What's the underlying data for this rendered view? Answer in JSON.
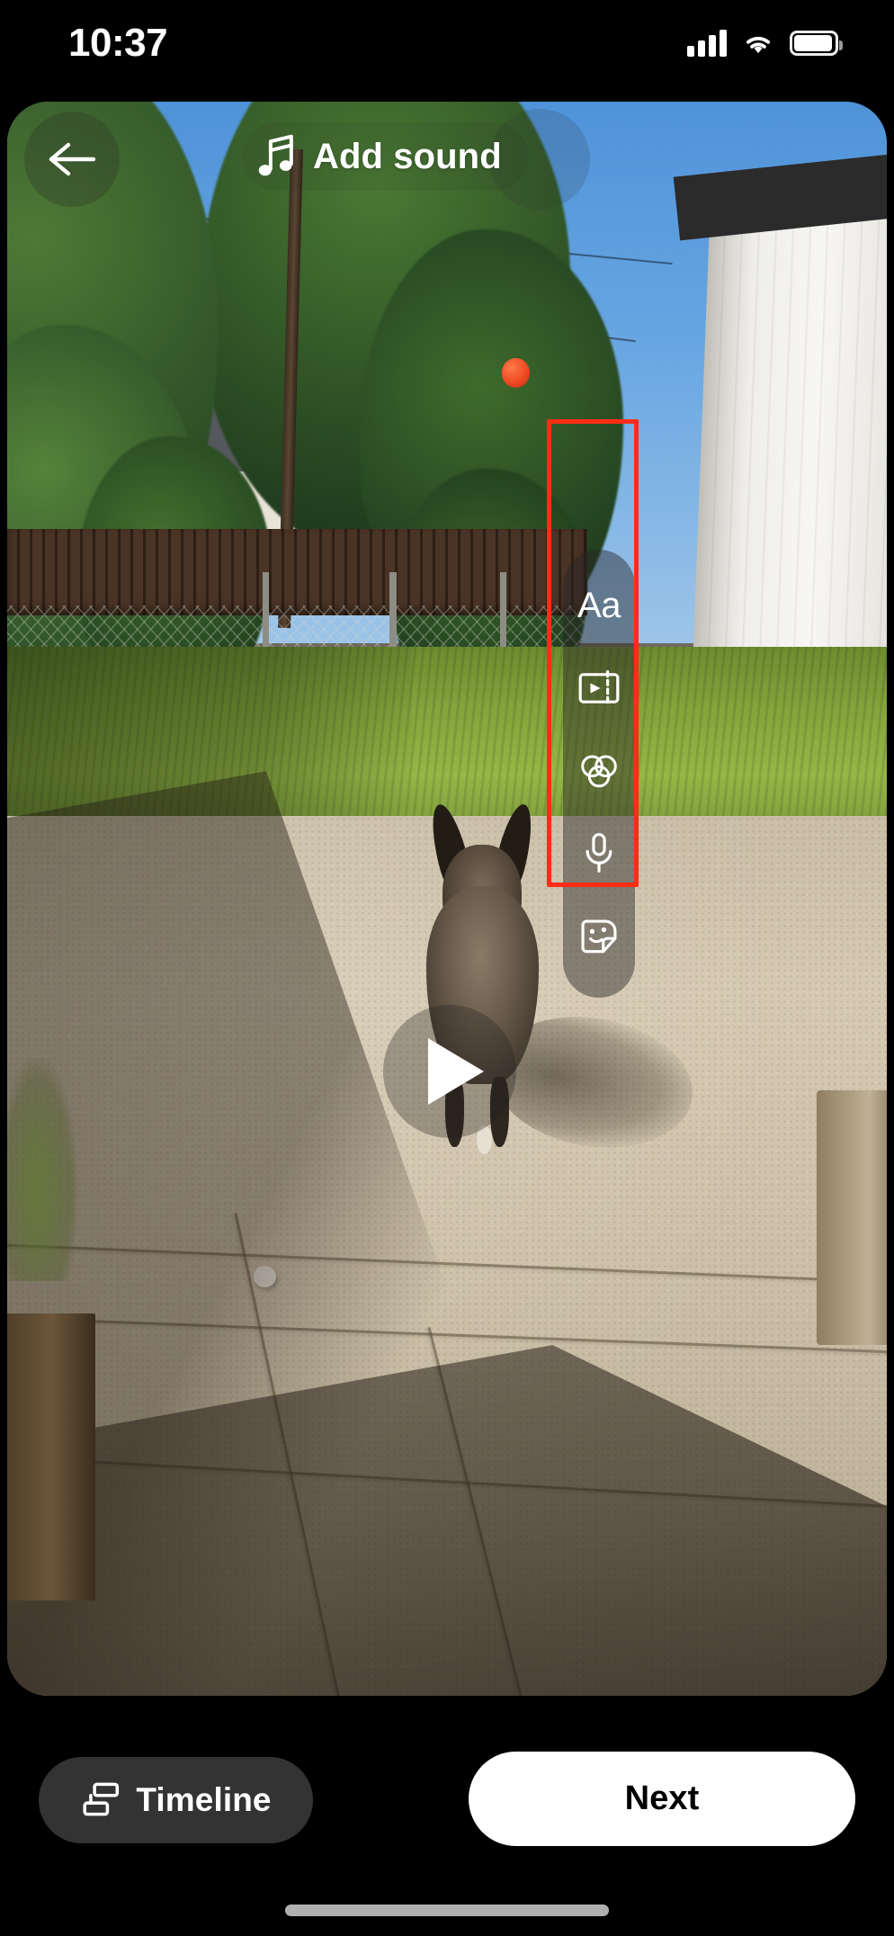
{
  "status_bar": {
    "time": "10:37",
    "icons": [
      "cellular-signal-icon",
      "wifi-icon",
      "battery-icon"
    ]
  },
  "editor": {
    "header": {
      "back_icon": "back-arrow-icon",
      "sound_icon": "music-note-icon",
      "add_sound_label": "Add sound"
    },
    "preview": {
      "play_icon": "play-icon",
      "description": "Video preview of a brindle dog running away on a concrete driveway in a sunlit backyard with trees, wooden and chain-link fencing, green grass and a white shed on the right."
    },
    "tool_rail": {
      "highlighted": true,
      "highlight_color": "#ff2d16",
      "items": [
        {
          "name": "text-tool",
          "label": "Aa",
          "icon": "text-aa-icon"
        },
        {
          "name": "edit-clip-tool",
          "label": "",
          "icon": "split-clip-icon"
        },
        {
          "name": "filters-tool",
          "label": "",
          "icon": "three-circles-filter-icon"
        },
        {
          "name": "voiceover-tool",
          "label": "",
          "icon": "microphone-icon"
        },
        {
          "name": "stickers-tool",
          "label": "",
          "icon": "sticker-smiley-icon"
        }
      ]
    },
    "bottom_bar": {
      "timeline_label": "Timeline",
      "timeline_icon": "timeline-stacked-bars-icon",
      "next_label": "Next",
      "next_highlighted": true,
      "highlight_color": "#ff2d16"
    }
  }
}
